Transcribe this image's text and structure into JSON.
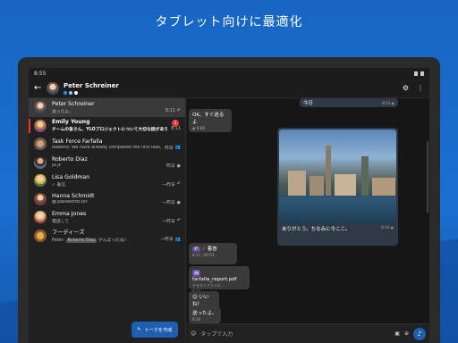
{
  "headline": "タブレット向けに最適化",
  "status": {
    "time": "8:55"
  },
  "appbar": {
    "title": "Peter Schreiner",
    "presence_colors": [
      "#2196f3",
      "#90caf9",
      "#ffffff"
    ]
  },
  "conversations": [
    {
      "name": "Peter Schreiner",
      "preview": "送ったよ。",
      "time": "8:11",
      "status_icon": "reply-icon",
      "selected": true,
      "unread": false
    },
    {
      "name": "Emily Young",
      "preview": "チームの皆さん、YLOプロジェクトについて大切な話があります",
      "time": "8:11",
      "status_icon": "",
      "unread": true,
      "badge": "1"
    },
    {
      "name": "Task Force Farfalla",
      "preview": "Roberto: We have already completed the first task, but",
      "time": "昨日",
      "status_icon": "group-icon"
    },
    {
      "name": "Roberto Diaz",
      "preview": "ja-JP",
      "time": "昨日",
      "status_icon": "eye-icon"
    },
    {
      "name": "Lisa Goldman",
      "preview": "✓ 着信",
      "time": "一昨日",
      "status_icon": "reply-icon"
    },
    {
      "name": "Hanna Schmidt",
      "preview": "passwords.txt",
      "time": "一昨日",
      "status_icon": "eye-icon"
    },
    {
      "name": "Emma Jones",
      "preview": "電話して",
      "time": "一昨日",
      "status_icon": "reply-icon"
    },
    {
      "name": "フーディーズ",
      "preview_sender": "Peter:",
      "preview_mention": "Roberto Diaz",
      "preview": "がんばったね！",
      "time": "一昨日",
      "status_icon": "group-icon"
    }
  ],
  "fab": {
    "label": "トークを作成"
  },
  "messages": {
    "m1": {
      "text": "OK、すぐ送るよ",
      "time": "8:08"
    },
    "m2": {
      "text": "今日",
      "time": "8:10"
    },
    "m3": {
      "caption": "ありがとう。ちなみに今ここ。",
      "time": "8:10"
    },
    "m4": {
      "text": "着信",
      "time": "8:11 | 00:53"
    },
    "m5": {
      "file": "farfalla_report.pdf",
      "type": "テキストファイル",
      "time": "8:13"
    },
    "m6": {
      "text": "いいね！",
      "time": "8:13"
    },
    "m7": {
      "text": "送ったよ。",
      "time": "8:16"
    }
  },
  "input": {
    "placeholder": "タップで入力"
  }
}
